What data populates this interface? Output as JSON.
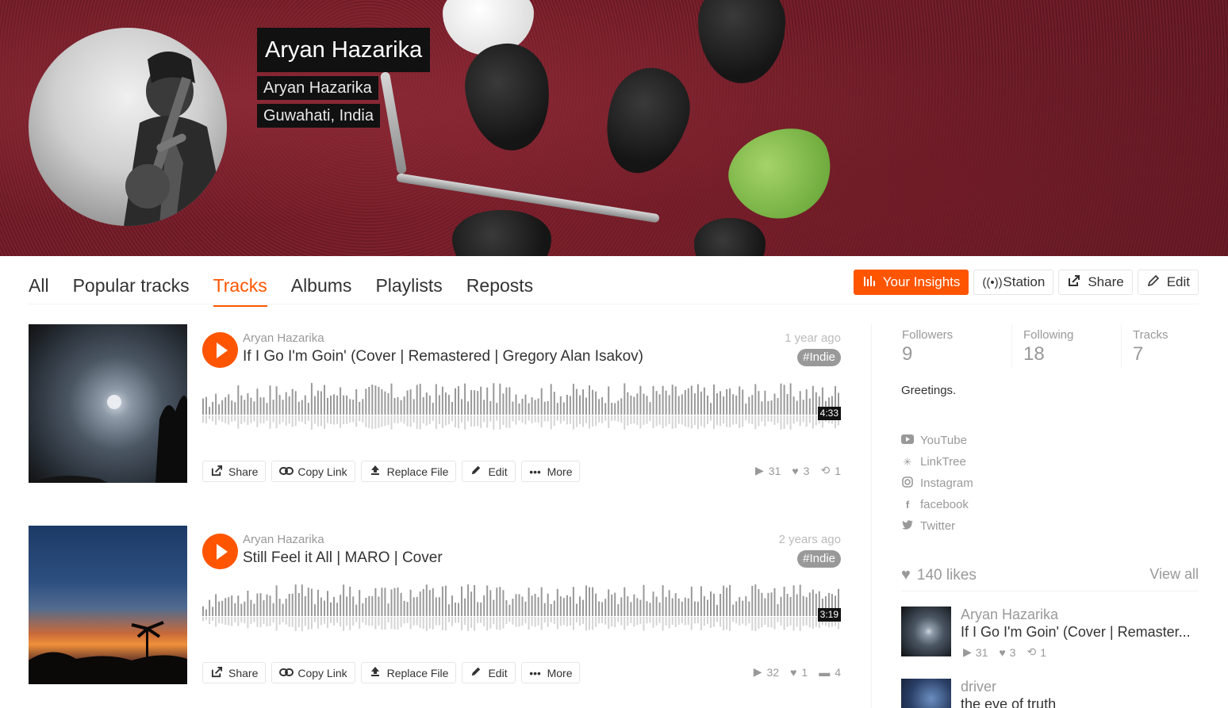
{
  "profile": {
    "display_name": "Aryan Hazarika",
    "username": "Aryan Hazarika",
    "location": "Guwahati, India"
  },
  "tabs": [
    {
      "label": "All"
    },
    {
      "label": "Popular tracks"
    },
    {
      "label": "Tracks"
    },
    {
      "label": "Albums"
    },
    {
      "label": "Playlists"
    },
    {
      "label": "Reposts"
    }
  ],
  "actions": {
    "insights": "Your Insights",
    "station": "Station",
    "share": "Share",
    "edit": "Edit"
  },
  "tracks": [
    {
      "user": "Aryan Hazarika",
      "title": "If I Go I'm Goin' (Cover | Remastered | Gregory Alan Isakov)",
      "ago": "1 year ago",
      "tag": "#Indie",
      "duration": "4:33",
      "buttons": {
        "share": "Share",
        "copy_link": "Copy Link",
        "replace_file": "Replace File",
        "edit": "Edit",
        "more": "More"
      },
      "plays": "31",
      "likes": "3",
      "reposts": "1"
    },
    {
      "user": "Aryan Hazarika",
      "title": "Still Feel it All | MARO | Cover",
      "ago": "2 years ago",
      "tag": "#Indie",
      "duration": "3:19",
      "buttons": {
        "share": "Share",
        "copy_link": "Copy Link",
        "replace_file": "Replace File",
        "edit": "Edit",
        "more": "More"
      },
      "plays": "32",
      "likes": "1",
      "comments": "4"
    }
  ],
  "sidebar": {
    "stats": [
      {
        "label": "Followers",
        "value": "9"
      },
      {
        "label": "Following",
        "value": "18"
      },
      {
        "label": "Tracks",
        "value": "7"
      }
    ],
    "bio": "Greetings.",
    "links": [
      {
        "label": "YouTube",
        "icon": "youtube-icon"
      },
      {
        "label": "LinkTree",
        "icon": "linktree-icon"
      },
      {
        "label": "Instagram",
        "icon": "instagram-icon"
      },
      {
        "label": "facebook",
        "icon": "facebook-icon"
      },
      {
        "label": "Twitter",
        "icon": "twitter-icon"
      }
    ],
    "likes_count": "140 likes",
    "view_all": "View all",
    "liked_tracks": [
      {
        "user": "Aryan Hazarika",
        "title": "If I Go I'm Goin' (Cover | Remaster...",
        "plays": "31",
        "likes": "3",
        "reposts": "1"
      },
      {
        "user": "driver",
        "title": "the eve of truth"
      }
    ]
  },
  "colors": {
    "accent": "#ff5500",
    "muted": "#999999",
    "hero_bg": "#74202b"
  }
}
